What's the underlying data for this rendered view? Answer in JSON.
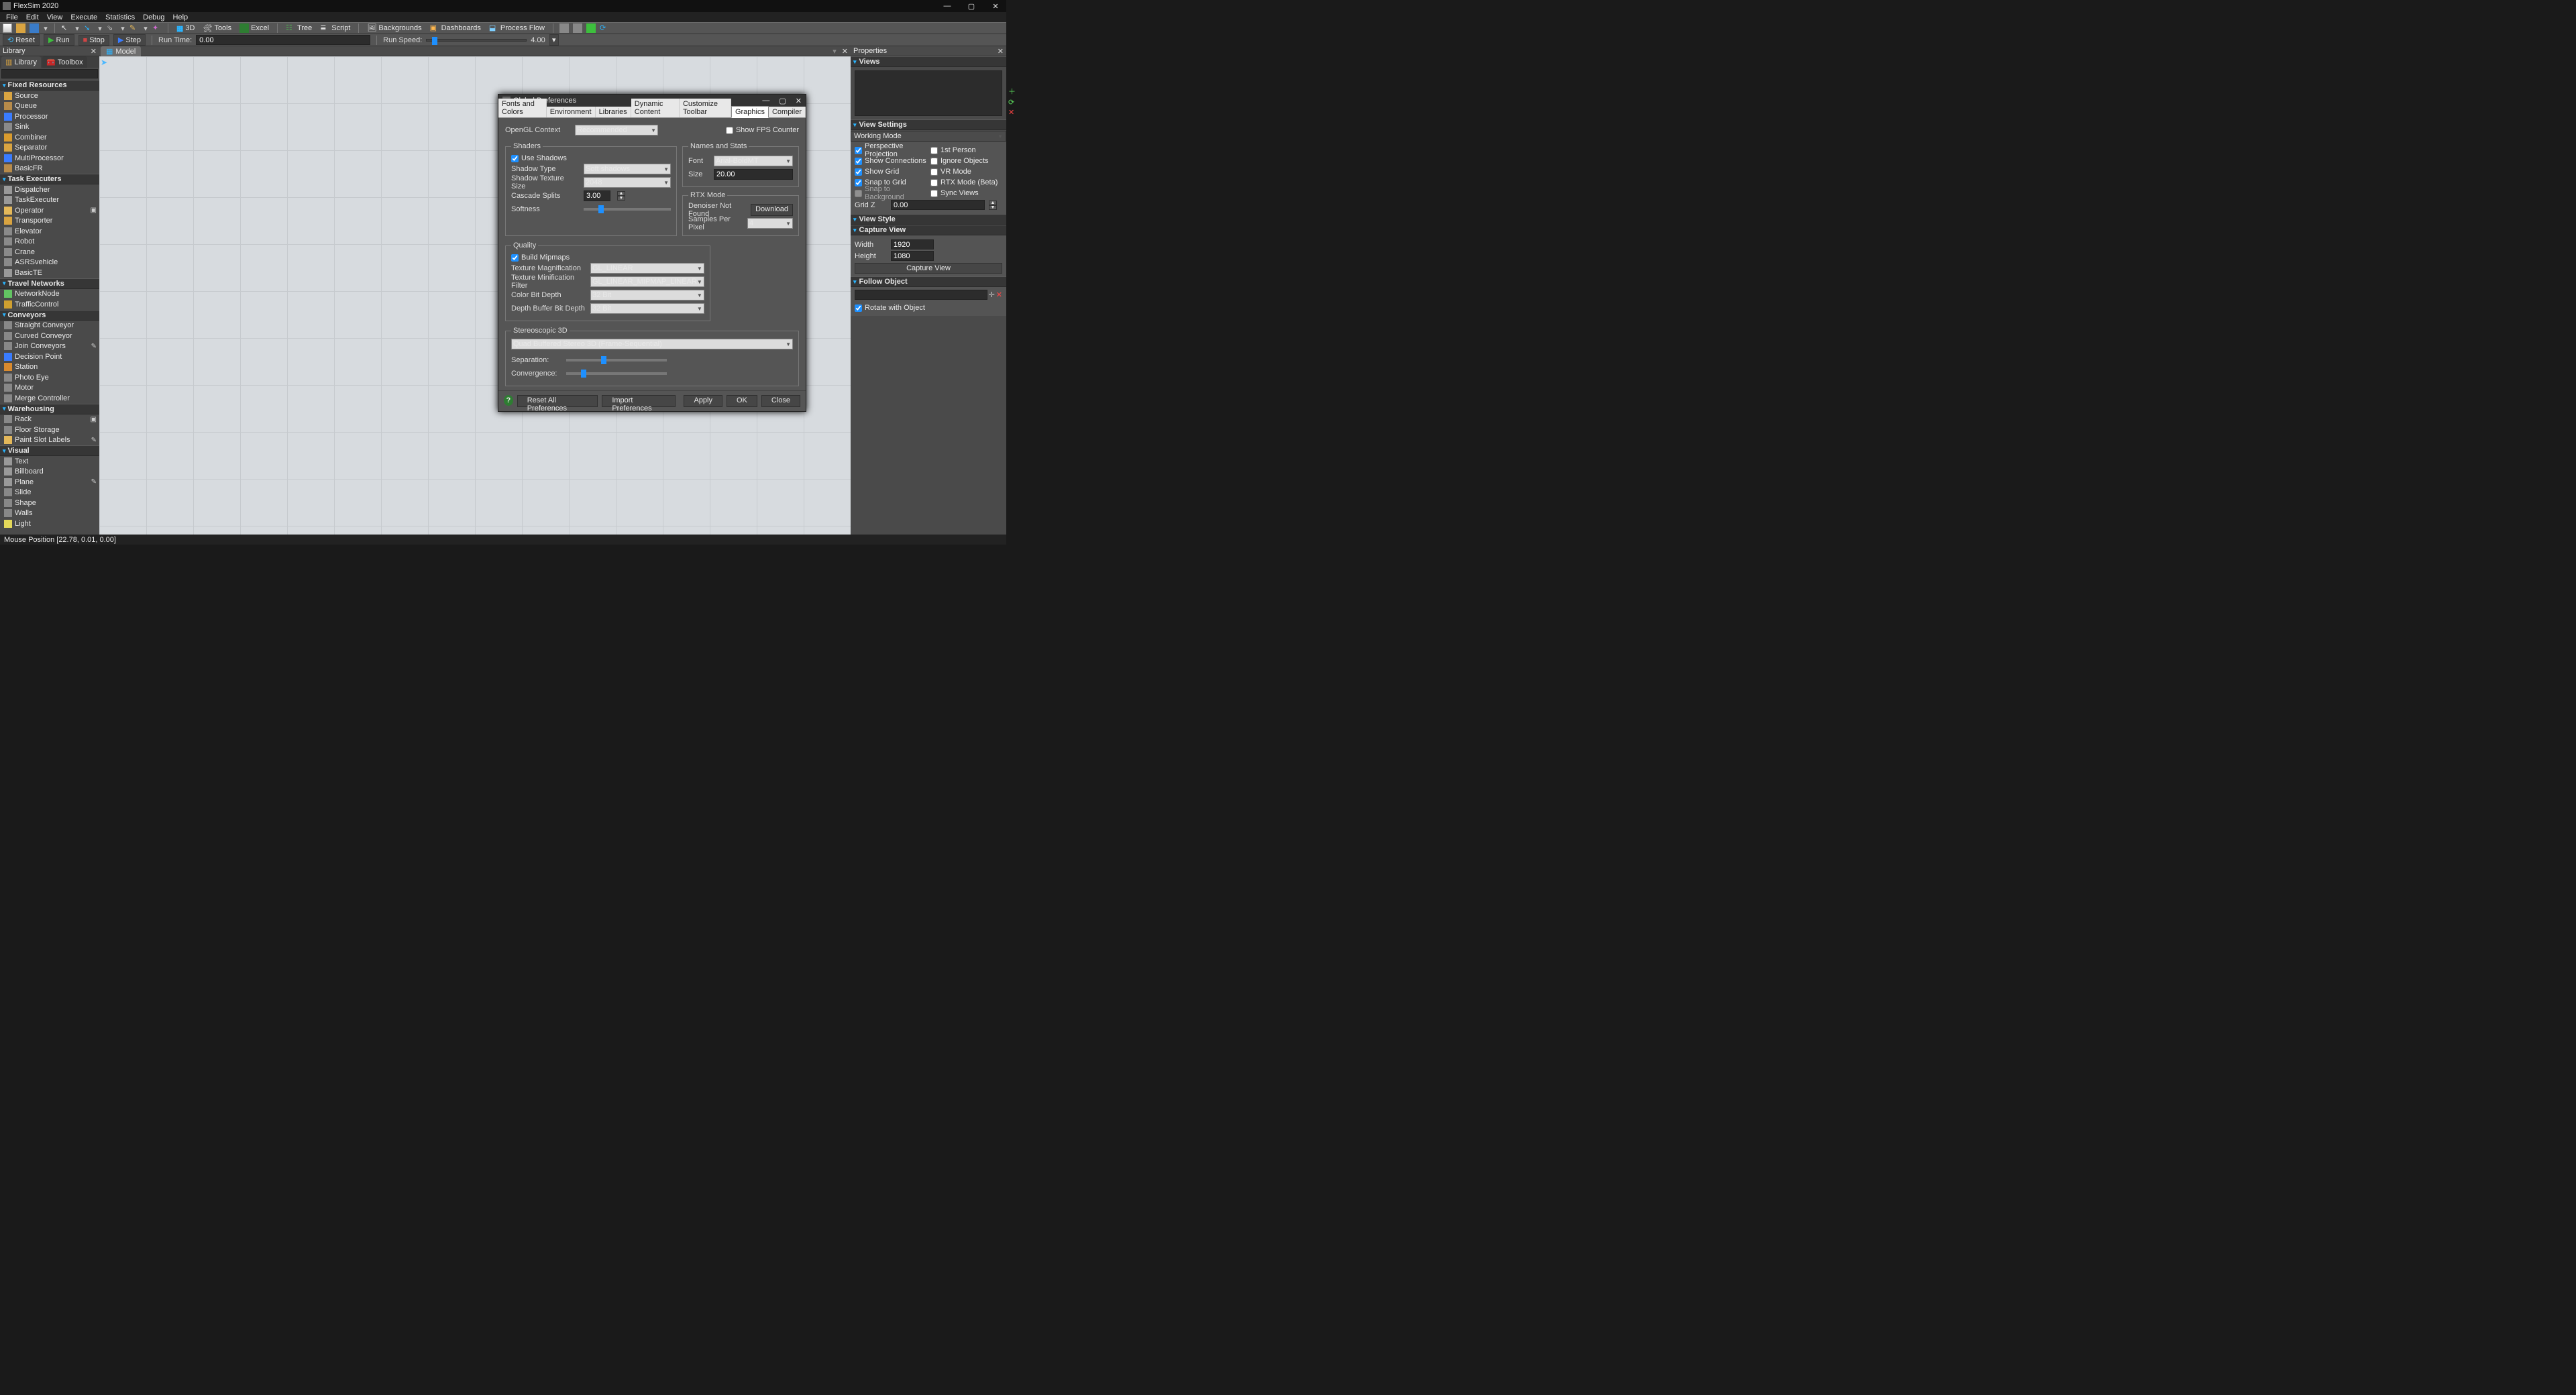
{
  "app": {
    "title": "FlexSim 2020"
  },
  "menu": [
    "File",
    "Edit",
    "View",
    "Execute",
    "Statistics",
    "Debug",
    "Help"
  ],
  "toolbar": {
    "btn3d": "3D",
    "tools": "Tools",
    "excel": "Excel",
    "tree": "Tree",
    "script": "Script",
    "backgrounds": "Backgrounds",
    "dashboards": "Dashboards",
    "processflow": "Process Flow"
  },
  "sim": {
    "reset": "Reset",
    "run": "Run",
    "stop": "Stop",
    "step": "Step",
    "runtime_label": "Run Time:",
    "runtime_value": "0.00",
    "runspeed_label": "Run Speed:",
    "runspeed_value": "4.00"
  },
  "library_panel": {
    "title": "Library",
    "tabs": {
      "library": "Library",
      "toolbox": "Toolbox"
    },
    "categories": [
      {
        "name": "Fixed Resources",
        "items": [
          {
            "label": "Source",
            "c": "#d9a441"
          },
          {
            "label": "Queue",
            "c": "#b78b4a"
          },
          {
            "label": "Processor",
            "c": "#3a7cff"
          },
          {
            "label": "Sink",
            "c": "#8a8a8a"
          },
          {
            "label": "Combiner",
            "c": "#d99b2e"
          },
          {
            "label": "Separator",
            "c": "#d9a441"
          },
          {
            "label": "MultiProcessor",
            "c": "#3a7cff"
          },
          {
            "label": "BasicFR",
            "c": "#b78b4a"
          }
        ]
      },
      {
        "name": "Task Executers",
        "items": [
          {
            "label": "Dispatcher",
            "c": "#999"
          },
          {
            "label": "TaskExecuter",
            "c": "#999"
          },
          {
            "label": "Operator",
            "c": "#e4b85a",
            "extra": "▣"
          },
          {
            "label": "Transporter",
            "c": "#d9a441"
          },
          {
            "label": "Elevator",
            "c": "#8a8a8a"
          },
          {
            "label": "Robot",
            "c": "#8a8a8a"
          },
          {
            "label": "Crane",
            "c": "#8a8a8a"
          },
          {
            "label": "ASRSvehicle",
            "c": "#8a8a8a"
          },
          {
            "label": "BasicTE",
            "c": "#999"
          }
        ]
      },
      {
        "name": "Travel Networks",
        "items": [
          {
            "label": "NetworkNode",
            "c": "#62c462"
          },
          {
            "label": "TrafficControl",
            "c": "#d0a030"
          }
        ]
      },
      {
        "name": "Conveyors",
        "items": [
          {
            "label": "Straight Conveyor",
            "c": "#888"
          },
          {
            "label": "Curved Conveyor",
            "c": "#888"
          },
          {
            "label": "Join Conveyors",
            "c": "#888",
            "extra": "✎"
          },
          {
            "label": "Decision Point",
            "c": "#3a7cff"
          },
          {
            "label": "Station",
            "c": "#d98a2e"
          },
          {
            "label": "Photo Eye",
            "c": "#888"
          },
          {
            "label": "Motor",
            "c": "#888"
          },
          {
            "label": "Merge Controller",
            "c": "#888"
          }
        ]
      },
      {
        "name": "Warehousing",
        "items": [
          {
            "label": "Rack",
            "c": "#888",
            "extra": "▣"
          },
          {
            "label": "Floor Storage",
            "c": "#888"
          },
          {
            "label": "Paint Slot Labels",
            "c": "#e4b85a",
            "extra": "✎"
          }
        ]
      },
      {
        "name": "Visual",
        "items": [
          {
            "label": "Text",
            "c": "#999"
          },
          {
            "label": "Billboard",
            "c": "#999"
          },
          {
            "label": "Plane",
            "c": "#999",
            "extra": "✎"
          },
          {
            "label": "Slide",
            "c": "#888"
          },
          {
            "label": "Shape",
            "c": "#888"
          },
          {
            "label": "Walls",
            "c": "#888"
          },
          {
            "label": "Light",
            "c": "#e4d85a"
          }
        ]
      }
    ]
  },
  "model_tab": "Model",
  "properties": {
    "title": "Properties",
    "views": "Views",
    "view_settings": "View Settings",
    "working_mode": "Working Mode",
    "perspective": "Perspective Projection",
    "first_person": "1st Person",
    "show_connections": "Show Connections",
    "ignore_objects": "Ignore Objects",
    "show_grid": "Show Grid",
    "vr_mode": "VR Mode",
    "snap_grid": "Snap to Grid",
    "rtx_beta": "RTX Mode (Beta)",
    "snap_bg": "Snap to Background",
    "sync_views": "Sync Views",
    "gridz_label": "Grid Z",
    "gridz_value": "0.00",
    "view_style": "View Style",
    "capture_view": "Capture View",
    "capture_btn": "Capture View",
    "width_label": "Width",
    "width_value": "1920",
    "height_label": "Height",
    "height_value": "1080",
    "follow_object": "Follow Object",
    "rotate_with_object": "Rotate with Object"
  },
  "statusbar": "Mouse Position [22.78, 0.01, 0.00]",
  "dialog": {
    "title": "Global Preferences",
    "tabs": [
      "Fonts and Colors",
      "Environment",
      "Libraries",
      "Dynamic Content",
      "Customize Toolbar",
      "Graphics",
      "Compiler"
    ],
    "active_tab": 5,
    "opengl_label": "OpenGL Context",
    "opengl_value": "Recommended",
    "show_fps": "Show FPS Counter",
    "shaders": {
      "legend": "Shaders",
      "use_shadows": "Use Shadows",
      "shadow_type_label": "Shadow Type",
      "shadow_type": "Soft shadows",
      "shadow_tex_label": "Shadow Texture Size",
      "shadow_tex": "2048",
      "cascade_label": "Cascade Splits",
      "cascade_value": "3.00",
      "softness_label": "Softness"
    },
    "names": {
      "legend": "Names and Stats",
      "font_label": "Font",
      "font_value": "Arial-BoldMT",
      "size_label": "Size",
      "size_value": "20.00"
    },
    "rtx": {
      "legend": "RTX Mode",
      "denoiser": "Denoiser Not Found",
      "download": "Download",
      "samples_label": "Samples Per Pixel",
      "samples_value": "4"
    },
    "quality": {
      "legend": "Quality",
      "mipmaps": "Build Mipmaps",
      "tex_mag_label": "Texture Magnification",
      "tex_mag": "GL_LINEAR",
      "tex_min_label": "Texture Minification Filter",
      "tex_min": "GL_LINEAR_MIPMAP_LINEAR",
      "color_depth_label": "Color Bit Depth",
      "color_depth": "32 Bit",
      "depth_buffer_label": "Depth Buffer Bit Depth",
      "depth_buffer": "32 Bit"
    },
    "stereo": {
      "legend": "Stereoscopic 3D",
      "mode": "Quad Buffered Stereo 3D (Frame-Sequential)",
      "separation": "Separation:",
      "convergence": "Convergence:"
    },
    "btn_reset": "Reset All Preferences",
    "btn_import": "Import Preferences",
    "btn_apply": "Apply",
    "btn_ok": "OK",
    "btn_close": "Close"
  }
}
